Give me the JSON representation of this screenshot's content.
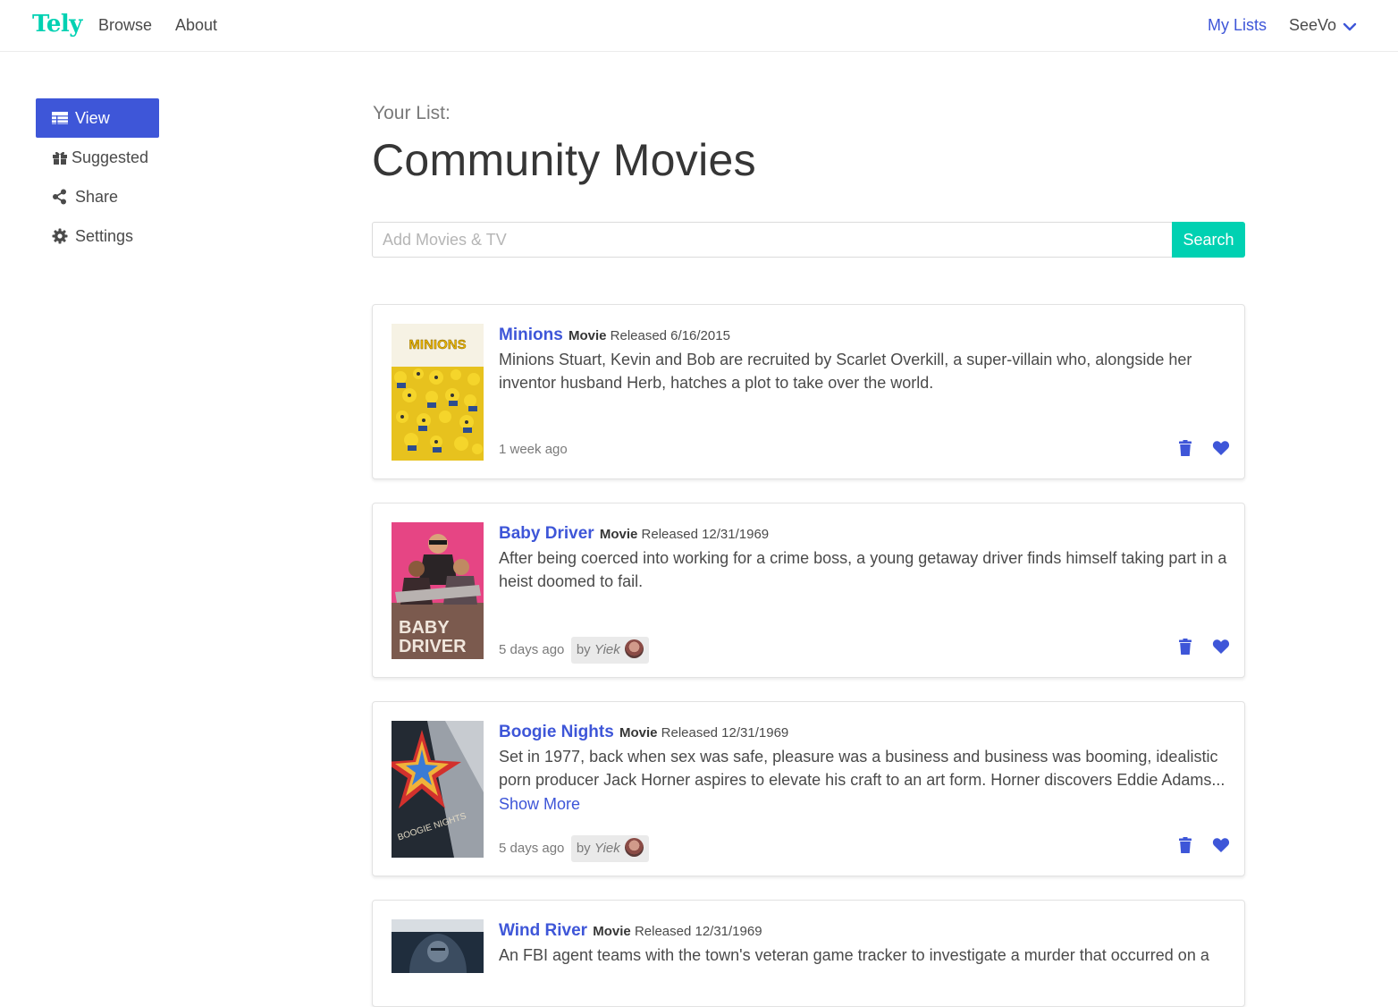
{
  "nav": {
    "brand": "Tely",
    "links": [
      "Browse",
      "About"
    ],
    "my_lists": "My Lists",
    "user": "SeeVo"
  },
  "sidebar": {
    "items": [
      {
        "label": "View",
        "icon": "table-icon",
        "active": true
      },
      {
        "label": "Suggested",
        "icon": "gift-icon",
        "active": false
      },
      {
        "label": "Share",
        "icon": "share-icon",
        "active": false
      },
      {
        "label": "Settings",
        "icon": "gear-icon",
        "active": false
      }
    ]
  },
  "main": {
    "subtitle": "Your List:",
    "title": "Community Movies",
    "search": {
      "placeholder": "Add Movies & TV",
      "button": "Search"
    }
  },
  "items": [
    {
      "title": "Minions",
      "type": "Movie",
      "released": "Released 6/16/2015",
      "description": "Minions Stuart, Kevin and Bob are recruited by Scarlet Overkill, a super-villain who, alongside her inventor husband Herb, hatches a plot to take over the world.",
      "time": "1 week ago"
    },
    {
      "title": "Baby Driver",
      "type": "Movie",
      "released": "Released 12/31/1969",
      "description": "After being coerced into working for a crime boss, a young getaway driver finds himself taking part in a heist doomed to fail.",
      "time": "5 days ago",
      "by": "by",
      "author": "Yiek"
    },
    {
      "title": "Boogie Nights",
      "type": "Movie",
      "released": "Released 12/31/1969",
      "description": "Set in 1977, back when sex was safe, pleasure was a business and business was booming, idealistic porn producer Jack Horner aspires to elevate his craft to an art form. Horner discovers Eddie Adams...",
      "show_more": "Show More",
      "time": "5 days ago",
      "by": "by",
      "author": "Yiek"
    },
    {
      "title": "Wind River",
      "type": "Movie",
      "released": "Released 12/31/1969",
      "description": "An FBI agent teams with the town's veteran game tracker to investigate a murder that occurred on a"
    }
  ],
  "posters": {
    "minions": "MINIONS",
    "baby_driver_1": "BABY",
    "baby_driver_2": "DRIVER",
    "boogie": "BOOGIE NIGHTS"
  },
  "colors": {
    "accent": "#3e56d8",
    "brand": "#00d1b2"
  }
}
